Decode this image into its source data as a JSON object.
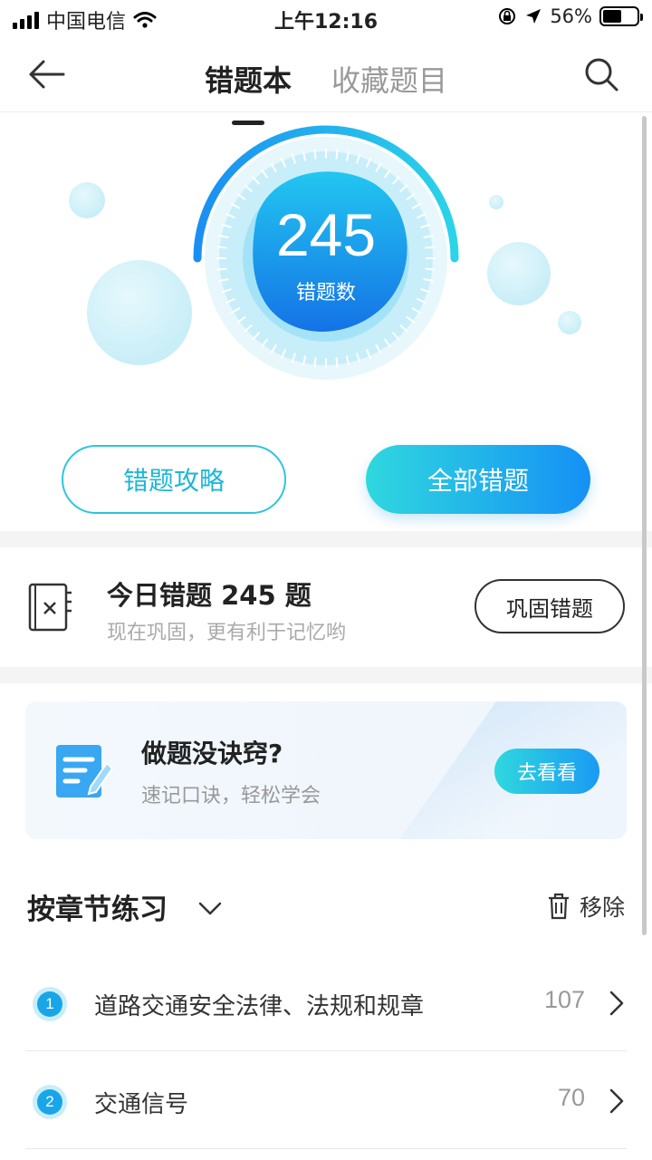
{
  "status_bar": {
    "carrier": "中国电信",
    "time": "上午12:16",
    "battery": "56%",
    "battery_level": 0.56
  },
  "nav": {
    "tabs": [
      {
        "label": "错题本",
        "active": true
      },
      {
        "label": "收藏题目",
        "active": false
      }
    ],
    "back_icon": "arrow-left-icon",
    "search_icon": "search-icon"
  },
  "summary": {
    "count": "245",
    "count_label": "错题数",
    "strategy_button": "错题攻略",
    "all_button": "全部错题"
  },
  "today": {
    "title": "今日错题 245 题",
    "subtitle": "现在巩固，更有利于记忆哟",
    "button": "巩固错题"
  },
  "promo": {
    "title": "做题没诀窍?",
    "subtitle": "速记口诀，轻松学会",
    "button": "去看看"
  },
  "section": {
    "title": "按章节练习",
    "remove_label": "移除"
  },
  "chapters": [
    {
      "index": "1",
      "name": "道路交通安全法律、法规和规章",
      "count": "107"
    },
    {
      "index": "2",
      "name": "交通信号",
      "count": "70"
    }
  ],
  "colors": {
    "accent": "#1fb6d6",
    "gradient_start": "#2fd8de",
    "gradient_end": "#1590f5"
  }
}
